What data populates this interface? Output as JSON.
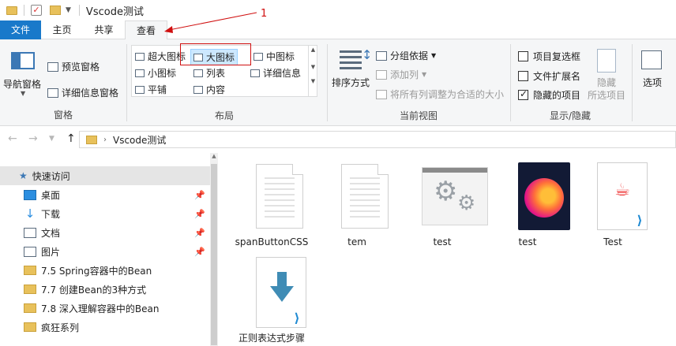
{
  "title": "Vscode测试",
  "annotation": {
    "number": "1"
  },
  "tabs": {
    "file": "文件",
    "home": "主页",
    "share": "共享",
    "view": "查看"
  },
  "ribbon": {
    "panes": {
      "label": "窗格",
      "nav_pane": "导航窗格",
      "preview_pane": "预览窗格",
      "details_pane": "详细信息窗格"
    },
    "layout": {
      "label": "布局",
      "extra_large": "超大图标",
      "large": "大图标",
      "medium": "中图标",
      "small": "小图标",
      "list": "列表",
      "details": "详细信息",
      "tiles": "平铺",
      "content": "内容",
      "selected": "大图标"
    },
    "current_view": {
      "label": "当前视图",
      "sort_by": "排序方式",
      "group_by": "分组依据",
      "add_columns": "添加列",
      "size_all_columns": "将所有列调整为合适的大小"
    },
    "show_hide": {
      "label": "显示/隐藏",
      "item_checkboxes": "项目复选框",
      "item_checkboxes_checked": false,
      "file_extensions": "文件扩展名",
      "file_extensions_checked": false,
      "hidden_items": "隐藏的项目",
      "hidden_items_checked": true,
      "hide_selected_line1": "隐藏",
      "hide_selected_line2": "所选项目"
    },
    "options": "选项"
  },
  "address": {
    "path": "Vscode测试"
  },
  "sidebar": {
    "quick_access": "快速访问",
    "items": [
      {
        "label": "桌面",
        "icon": "desktop-icon",
        "pinned": true
      },
      {
        "label": "下载",
        "icon": "download-icon",
        "pinned": true
      },
      {
        "label": "文档",
        "icon": "document-icon",
        "pinned": true
      },
      {
        "label": "图片",
        "icon": "picture-icon",
        "pinned": true
      },
      {
        "label": "7.5 Spring容器中的Bean",
        "icon": "folder-icon",
        "pinned": false
      },
      {
        "label": "7.7 创建Bean的3种方式",
        "icon": "folder-icon",
        "pinned": false
      },
      {
        "label": "7.8 深入理解容器中的Bean",
        "icon": "folder-icon",
        "pinned": false
      },
      {
        "label": "疯狂系列",
        "icon": "folder-icon",
        "pinned": false
      }
    ]
  },
  "files": [
    {
      "name": "spanButtonCSS",
      "icon": "text-file-icon"
    },
    {
      "name": "tem",
      "icon": "text-file-icon"
    },
    {
      "name": "test",
      "icon": "application-icon"
    },
    {
      "name": "test",
      "icon": "firefox-html-icon"
    },
    {
      "name": "Test",
      "icon": "java-vscode-icon"
    },
    {
      "name": "正则表达式步骤",
      "icon": "vscode-download-icon"
    }
  ],
  "colors": {
    "accent": "#1979ca",
    "annotation": "#d01010",
    "selection": "#cce8ff"
  }
}
